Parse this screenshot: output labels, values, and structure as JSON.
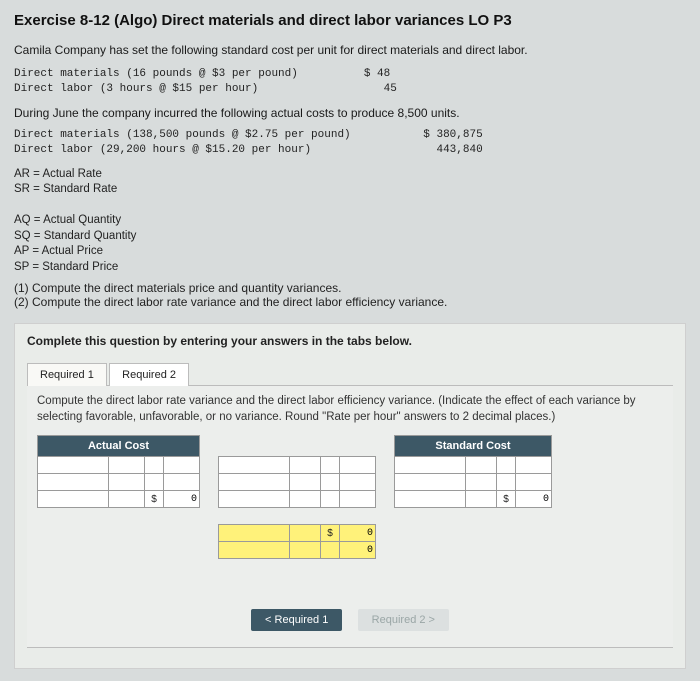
{
  "title": "Exercise 8-12 (Algo) Direct materials and direct labor variances LO P3",
  "intro": "Camila Company has set the following standard cost per unit for direct materials and direct labor.",
  "std": {
    "line1": "Direct materials (16 pounds @ $3 per pound)          $ 48",
    "line2": "Direct labor (3 hours @ $15 per hour)                   45"
  },
  "during": "During June the company incurred the following actual costs to produce 8,500 units.",
  "act": {
    "line1": "Direct materials (138,500 pounds @ $2.75 per pound)           $ 380,875",
    "line2": "Direct labor (29,200 hours @ $15.20 per hour)                   443,840"
  },
  "legend": {
    "l1": "AR = Actual Rate",
    "l2": "SR = Standard Rate",
    "l3": "AQ = Actual Quantity",
    "l4": "SQ = Standard Quantity",
    "l5": "AP = Actual Price",
    "l6": "SP = Standard Price"
  },
  "tasks": {
    "t1": "(1) Compute the direct materials price and quantity variances.",
    "t2": "(2) Compute the direct labor rate variance and the direct labor efficiency variance."
  },
  "panel_head": "Complete this question by entering your answers in the tabs below.",
  "tabs": {
    "tab1": "Required 1",
    "tab2": "Required 2"
  },
  "prompt": "Compute the direct labor rate variance and the direct labor efficiency variance. (Indicate the effect of each variance by selecting favorable, unfavorable, or no variance. Round \"Rate per hour\" answers to 2 decimal places.)",
  "headers": {
    "actual": "Actual Cost",
    "standard": "Standard Cost"
  },
  "cells": {
    "dollar": "$",
    "zeroA": "0",
    "zeroB": "0",
    "zeroC": "0",
    "zeroD": "0",
    "zeroE": "0"
  },
  "nav": {
    "prev": "<  Required 1",
    "next": "Required 2  >"
  },
  "chart_data": {
    "type": "table",
    "standard_costs": {
      "direct_materials": {
        "qty": 16,
        "unit": "pounds",
        "rate": 3,
        "total": 48
      },
      "direct_labor": {
        "qty": 3,
        "unit": "hours",
        "rate": 15,
        "total": 45
      }
    },
    "actual_costs": {
      "units_produced": 8500,
      "direct_materials": {
        "qty": 138500,
        "unit": "pounds",
        "rate": 2.75,
        "total": 380875
      },
      "direct_labor": {
        "qty": 29200,
        "unit": "hours",
        "rate": 15.2,
        "total": 443840
      }
    }
  }
}
